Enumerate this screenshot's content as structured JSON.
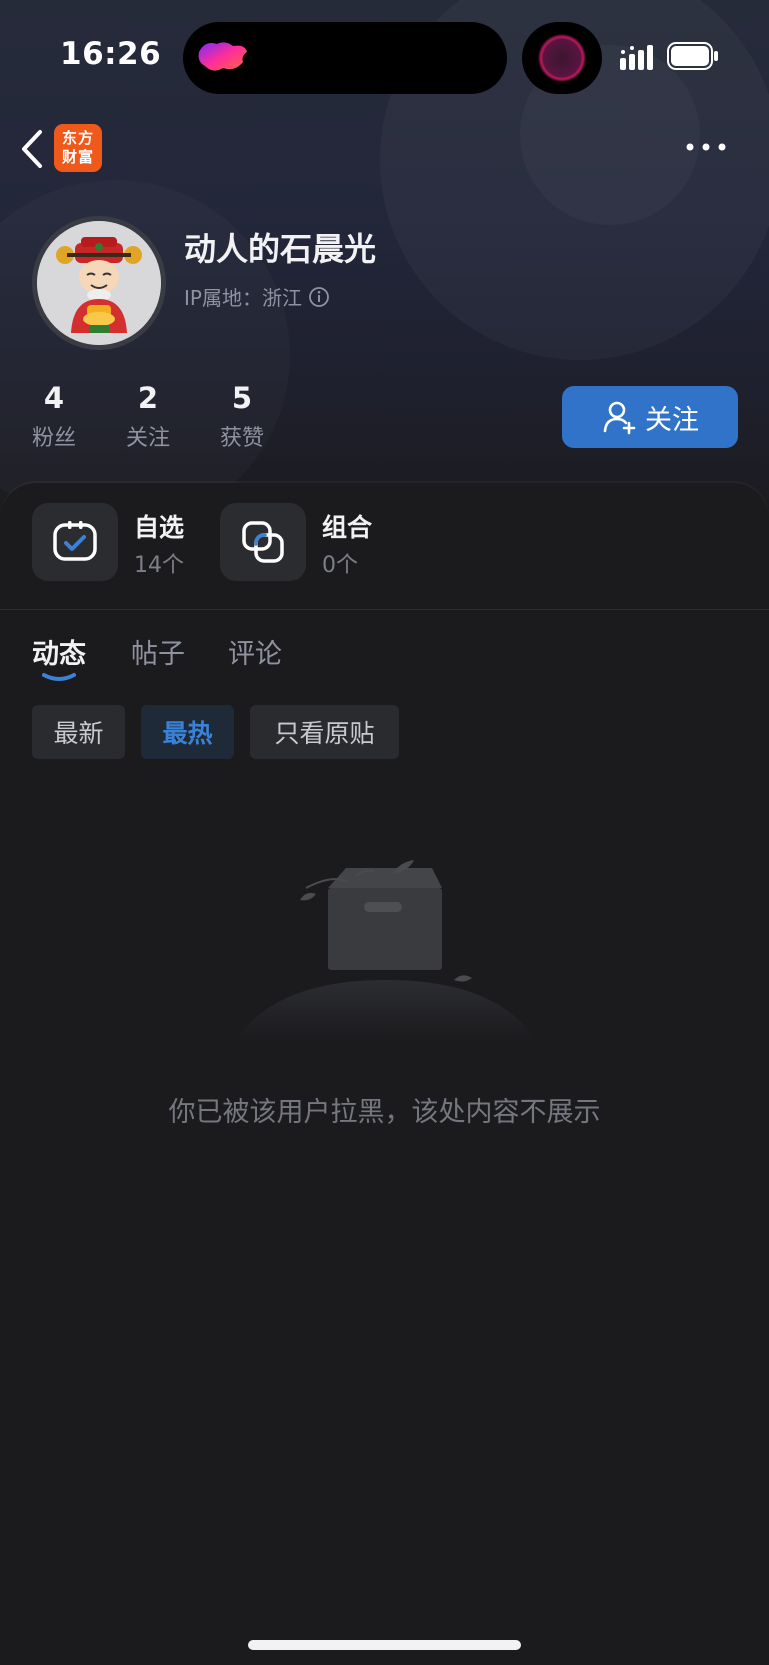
{
  "status_bar": {
    "time": "16:26"
  },
  "nav": {
    "app_logo_line1": "东方",
    "app_logo_line2": "财富"
  },
  "profile": {
    "username": "动人的石晨光",
    "ip_location": "IP属地：浙江"
  },
  "stats": [
    {
      "value": "4",
      "label": "粉丝"
    },
    {
      "value": "2",
      "label": "关注"
    },
    {
      "value": "5",
      "label": "获赞"
    }
  ],
  "follow_button": {
    "label": "关注"
  },
  "tools": [
    {
      "title": "自选",
      "count": "14个"
    },
    {
      "title": "组合",
      "count": "0个"
    }
  ],
  "tabs": [
    {
      "label": "动态",
      "active": true
    },
    {
      "label": "帖子",
      "active": false
    },
    {
      "label": "评论",
      "active": false
    }
  ],
  "filters": [
    {
      "label": "最新",
      "active": false
    },
    {
      "label": "最热",
      "active": true
    },
    {
      "label": "只看原贴",
      "active": false
    }
  ],
  "empty_state": {
    "message": "你已被该用户拉黑，该处内容不展示"
  },
  "colors": {
    "accent": "#3173c9",
    "background": "#1b1b1e",
    "logo": "#ef5a1c"
  }
}
